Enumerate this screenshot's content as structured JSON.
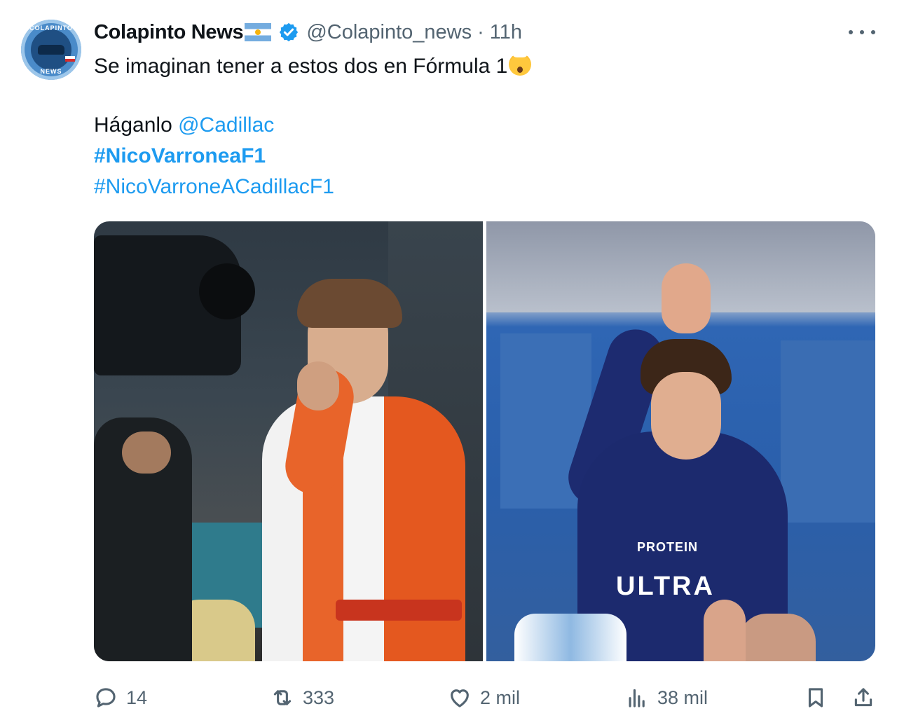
{
  "tweet": {
    "author_name": "Colapinto News",
    "handle": "@Colapinto_news",
    "separator": "·",
    "time": "11h",
    "avatar_text_top": "COLAPINTO",
    "avatar_text_bottom": "NEWS",
    "line1": "Se imaginan tener a estos dos en Fórmula 1",
    "line2_prefix": "Háganlo ",
    "mention": "@Cadillac",
    "hashtag1": "#NicoVarroneaF1",
    "hashtag2": "#NicoVarroneACadillacF1",
    "photo_right_lettering": "ULTRA",
    "photo_right_lettering2": "PROTEIN"
  },
  "actions": {
    "replies": "14",
    "reposts": "333",
    "likes": "2 mil",
    "views": "38 mil"
  },
  "colors": {
    "link": "#1d9bf0",
    "text": "#0f1419",
    "secondary": "#536471"
  },
  "icons": [
    "verified-badge-icon",
    "more-icon",
    "reply-icon",
    "repost-icon",
    "like-icon",
    "views-icon",
    "bookmark-icon",
    "share-icon"
  ]
}
